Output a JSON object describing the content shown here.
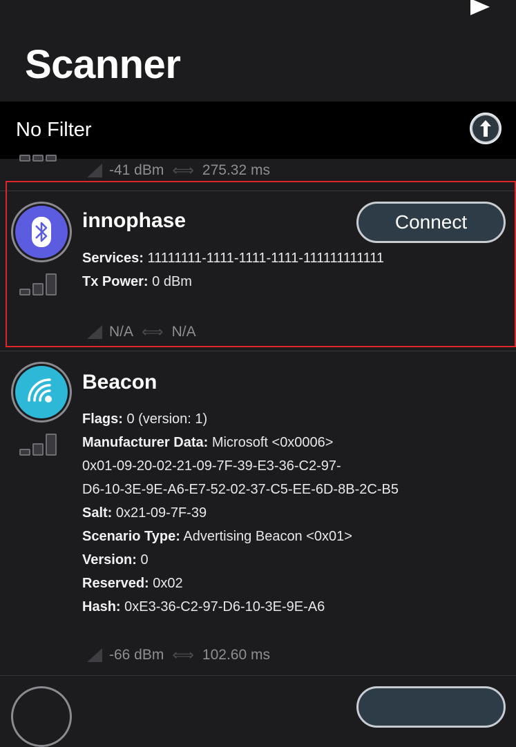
{
  "header": {
    "title": "Scanner"
  },
  "filter": {
    "label": "No Filter"
  },
  "colors": {
    "accent": "#5b5ce0",
    "beacon": "#2eb8d8",
    "highlight": "#e0262a"
  },
  "devices": [
    {
      "rssi": "-41 dBm",
      "interval": "275.32 ms"
    },
    {
      "name": "innophase",
      "icon": "bluetooth-icon",
      "connect_label": "Connect",
      "details": [
        {
          "key": "Services:",
          "value": "11111111-1111-1111-1111-111111111111"
        },
        {
          "key": "Tx Power:",
          "value": "0 dBm"
        }
      ],
      "rssi": "N/A",
      "interval": "N/A"
    },
    {
      "name": "Beacon",
      "icon": "beacon-icon",
      "details": [
        {
          "key": "Flags:",
          "value": "0 (version: 1)"
        },
        {
          "key": "Manufacturer Data:",
          "value": "Microsoft <0x0006>"
        },
        {
          "key": "",
          "value": "0x01-09-20-02-21-09-7F-39-E3-36-C2-97-"
        },
        {
          "key": "",
          "value": "D6-10-3E-9E-A6-E7-52-02-37-C5-EE-6D-8B-2C-B5"
        },
        {
          "key": "Salt:",
          "value": "0x21-09-7F-39"
        },
        {
          "key": "Scenario Type:",
          "value": "Advertising Beacon <0x01>"
        },
        {
          "key": "Version:",
          "value": "0"
        },
        {
          "key": "Reserved:",
          "value": "0x02"
        },
        {
          "key": "Hash:",
          "value": "0xE3-36-C2-97-D6-10-3E-9E-A6"
        }
      ],
      "rssi": "-66 dBm",
      "interval": "102.60 ms"
    }
  ]
}
